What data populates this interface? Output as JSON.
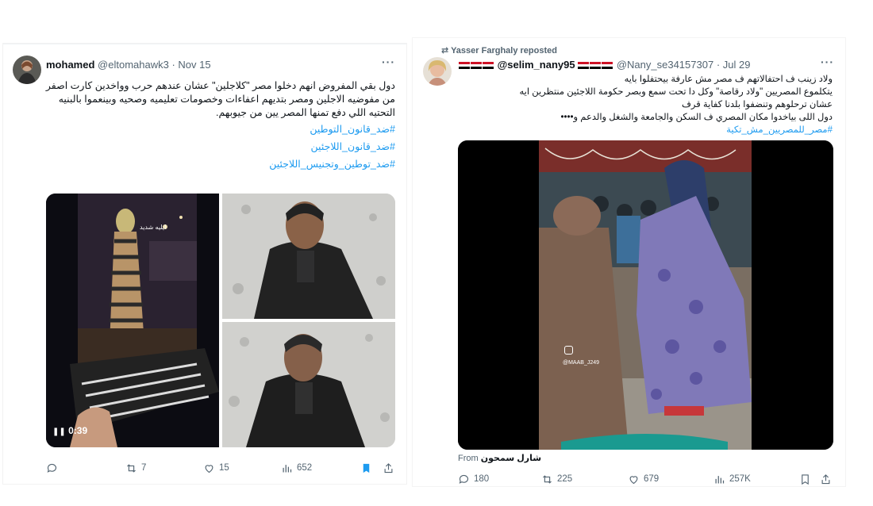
{
  "left_tweet": {
    "author_name": "mohamed",
    "handle": "@eltomahawk3",
    "date": "Nov 15",
    "more_icon": "more-icon",
    "text_lines": [
      "دول بقي المفروض انهم دخلوا مصر \"كلاجلين\" عشان عندهم حرب وواخدين كارت اصفر",
      "من مفوضيه الاجلين ومصر بتديهم اعفاءات وخصومات تعليميه وصحيه وبينعموا بالبنيه",
      "التحتيه اللي دفع تمنها المصر يين من جيوبهم."
    ],
    "hashtags": [
      "#ضد_قانون_التوطين",
      "#ضد_قانون_اللاجئين",
      "#ضد_توطين_وتجنيس_اللاجئين"
    ],
    "video_duration": "0:39",
    "video_caption": "ايليه شديد",
    "actions": {
      "reply": "",
      "repost": "7",
      "like": "15",
      "views": "652"
    }
  },
  "right_tweet": {
    "reposted_by": "Yasser Farghaly reposted",
    "author_name": "@selim_nany95",
    "handle": "@Nany_se34157307",
    "date": "Jul 29",
    "text_lines": [
      "ولاد زينب ف احتفالاتهم ف مصر مش عارفة بيحتفلوا بايه",
      "يتكلموع المصريين \"ولاد رقاصة\" وكل دا تحت سمع وبصر حكومة اللاجئين منتظرين ايه",
      "عشان ترحلوهم وتنضفوا بلدنا كفاية قرف",
      "دول اللى بياخدوا مكان المصري ف السكن والجامعة والشغل والدعم و••••"
    ],
    "hashtag": "#مصر_للمصريين_مش_تكية",
    "video_watermark": "@MAAB_J249",
    "from_label": "From",
    "from_name": "شارل سمحون",
    "actions": {
      "reply": "180",
      "repost": "225",
      "like": "679",
      "views": "257K"
    }
  },
  "colors": {
    "link": "#1d9bf0",
    "bookmark_active": "#1d9bf0",
    "muted": "#536471"
  }
}
